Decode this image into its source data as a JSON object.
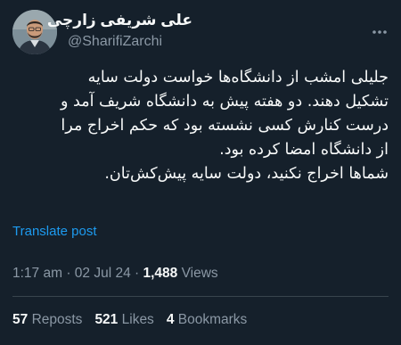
{
  "author": {
    "display_name": "علی شریفی زارچی",
    "handle": "@SharifiZarchi"
  },
  "tweet": {
    "text": "جلیلی امشب از دانشگاه‌ها خواست دولت سایه\nتشکیل دهند. دو هفته پیش به دانشگاه شریف آمد و\nدرست کنارش کسی نشسته بود که حکم اخراج مرا\nاز دانشگاه امضا کرده بود.\nشماها اخراج نکنید، دولت سایه پیش‌کش‌تان."
  },
  "translate_label": "Translate post",
  "meta": {
    "time": "1:17 am",
    "date": "02 Jul 24",
    "views_count": "1,488",
    "views_label": "Views"
  },
  "stats": {
    "reposts_count": "57",
    "reposts_label": "Reposts",
    "likes_count": "521",
    "likes_label": "Likes",
    "bookmarks_count": "4",
    "bookmarks_label": "Bookmarks"
  },
  "icons": {
    "more": "more-horizontal-icon",
    "avatar": "profile-photo"
  },
  "colors": {
    "background": "#15202b",
    "text_primary": "#f7f9f9",
    "text_secondary": "#8b98a5",
    "link": "#1d9bf0",
    "divider": "#38444d"
  }
}
